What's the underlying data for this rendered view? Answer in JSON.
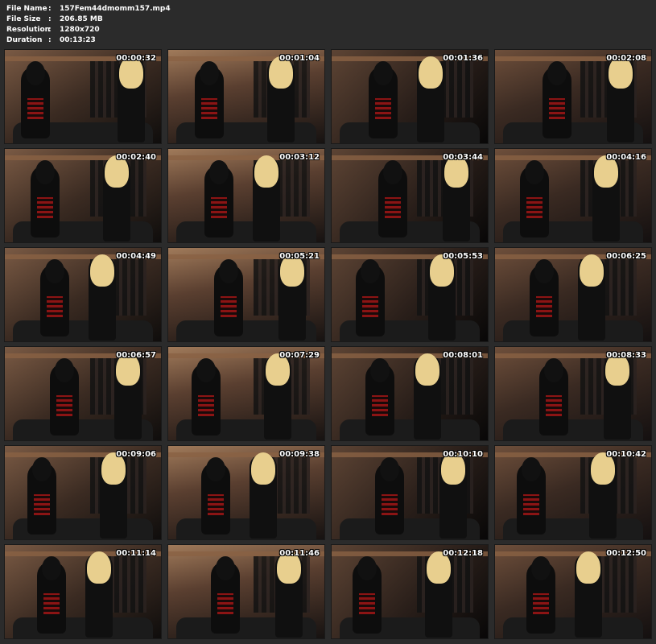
{
  "file_info": {
    "rows": [
      {
        "label": "File Name",
        "value": "157Fem44dmomm157.mp4"
      },
      {
        "label": "File Size",
        "value": "206.85 MB"
      },
      {
        "label": "Resolution",
        "value": "1280x720"
      },
      {
        "label": "Duration",
        "value": "00:13:23"
      }
    ],
    "separator": ":"
  },
  "thumbnails": [
    {
      "time": "00:00:32"
    },
    {
      "time": "00:01:04"
    },
    {
      "time": "00:01:36"
    },
    {
      "time": "00:02:08"
    },
    {
      "time": "00:02:40"
    },
    {
      "time": "00:03:12"
    },
    {
      "time": "00:03:44"
    },
    {
      "time": "00:04:16"
    },
    {
      "time": "00:04:49"
    },
    {
      "time": "00:05:21"
    },
    {
      "time": "00:05:53"
    },
    {
      "time": "00:06:25"
    },
    {
      "time": "00:06:57"
    },
    {
      "time": "00:07:29"
    },
    {
      "time": "00:08:01"
    },
    {
      "time": "00:08:33"
    },
    {
      "time": "00:09:06"
    },
    {
      "time": "00:09:38"
    },
    {
      "time": "00:10:10"
    },
    {
      "time": "00:10:42"
    },
    {
      "time": "00:11:14"
    },
    {
      "time": "00:11:46"
    },
    {
      "time": "00:12:18"
    },
    {
      "time": "00:12:50"
    }
  ]
}
